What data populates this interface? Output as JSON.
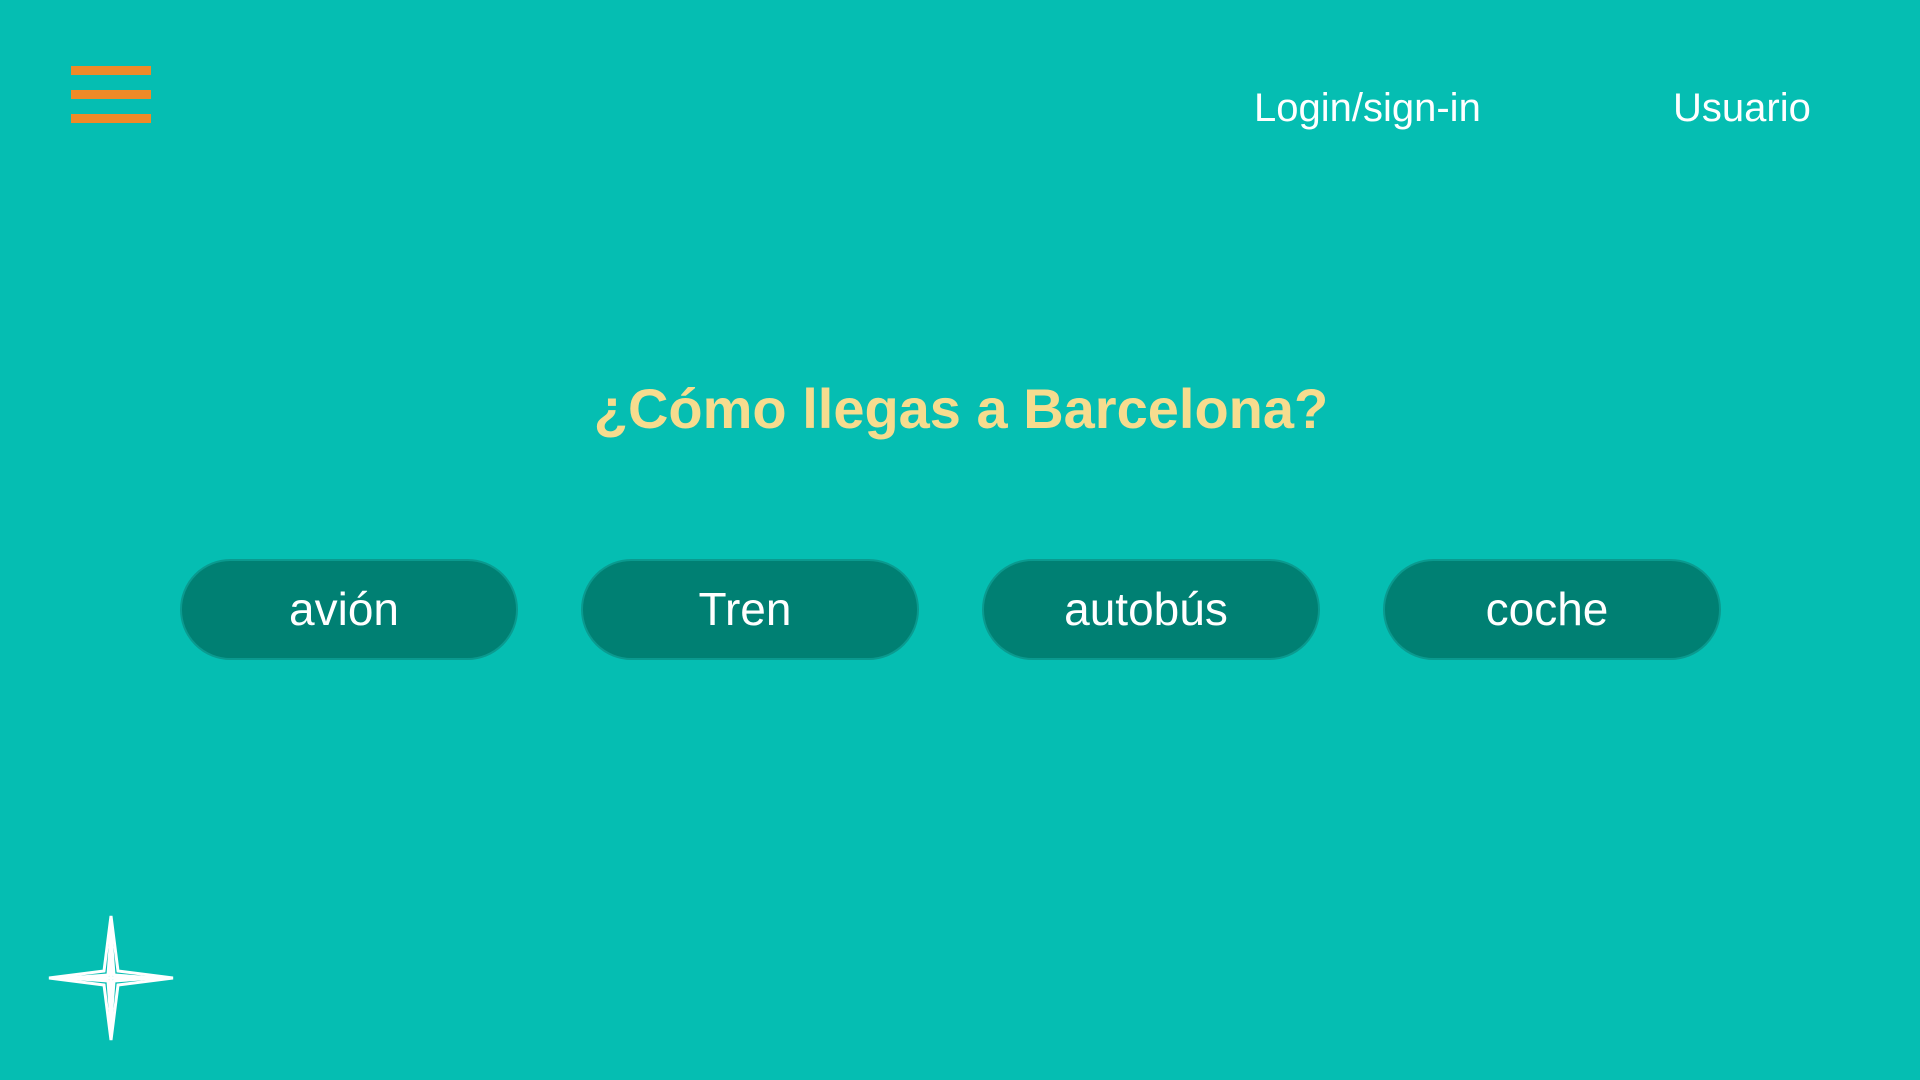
{
  "header": {
    "menu_icon": "hamburger-menu-icon",
    "login_label": "Login/sign-in",
    "user_label": "Usuario"
  },
  "main": {
    "question": "¿Cómo llegas a Barcelona?",
    "options": [
      {
        "label": "avión"
      },
      {
        "label": "Tren"
      },
      {
        "label": "autobús"
      },
      {
        "label": "coche"
      }
    ]
  },
  "footer": {
    "logo_icon": "compass-star-icon"
  },
  "colors": {
    "background": "#05beb2",
    "accent_orange": "#ef8a27",
    "title_yellow": "#f6dc8e",
    "button_fill": "#008073",
    "text_white": "#ffffff"
  }
}
